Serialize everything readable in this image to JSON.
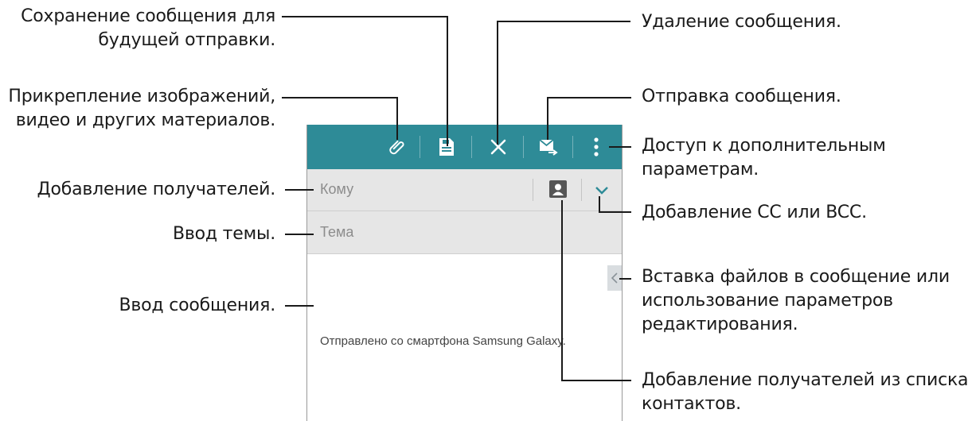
{
  "annotations": {
    "save": {
      "line1": "Сохранение сообщения для",
      "line2": "будущей отправки."
    },
    "attach": {
      "line1": "Прикрепление изображений,",
      "line2": "видео и других материалов."
    },
    "add_recipients": "Добавление получателей.",
    "enter_subject": "Ввод темы.",
    "enter_message": "Ввод сообщения.",
    "delete": "Удаление сообщения.",
    "send": "Отправка сообщения.",
    "more": {
      "line1": "Доступ к дополнительным",
      "line2": "параметрам."
    },
    "cc_bcc": "Добавление CC или BCC.",
    "insert": {
      "line1": "Вставка файлов в сообщение или",
      "line2": "использование параметров",
      "line3": "редактирования."
    },
    "contacts": {
      "line1": "Добавление получателей из списка",
      "line2": "контактов."
    }
  },
  "compose": {
    "to_placeholder": "Кому",
    "subject_placeholder": "Тема",
    "signature": "Отправлено со смартфона Samsung Galaxy."
  },
  "colors": {
    "toolbar": "#2e8b97",
    "field_bg": "#e6e6e6"
  },
  "icons": [
    "paperclip-icon",
    "save-draft-icon",
    "close-icon",
    "send-mail-icon",
    "more-vert-icon",
    "contact-icon",
    "chevron-down-icon",
    "chevron-left-icon"
  ]
}
